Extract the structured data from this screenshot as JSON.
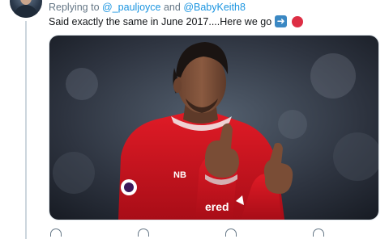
{
  "reply": {
    "prefix": "Replying to",
    "mention_1": "@_pauljoyce",
    "conjunction": "and",
    "mention_2": "@BabyKeith8"
  },
  "tweet": {
    "text": "Said exactly the same in June 2017....Here we go",
    "emoji_1": "right-arrow-emoji",
    "emoji_2": "red-circle-emoji"
  },
  "media": {
    "kind": "photo",
    "shirt_color": "#d0121f",
    "shirt_text_partial": "ered",
    "sleeve_logo": "NB"
  },
  "colors": {
    "link": "#1b95e0",
    "muted": "#657786",
    "text": "#14171a"
  }
}
